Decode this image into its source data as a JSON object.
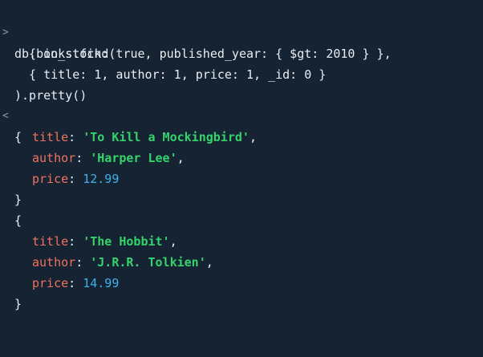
{
  "colors": {
    "background": "#152333",
    "key": "#f0715f",
    "string": "#34d36b",
    "number": "#3fb1ea",
    "text": "#e8edf2",
    "prompt": "#8a97a6"
  },
  "input": {
    "prompt_glyph": ">",
    "lines": [
      "db.books.find(",
      "  { in_stock: true, published_year: { $gt: 2010 } },",
      "  { title: 1, author: 1, price: 1, _id: 0 }",
      ").pretty()"
    ]
  },
  "output": {
    "result_glyph": "<",
    "open_brace": "{",
    "close_brace": "}",
    "comma": ",",
    "separator": ": ",
    "documents": [
      {
        "fields": [
          {
            "key": "title",
            "value": "'To Kill a Mockingbird'"
          },
          {
            "key": "author",
            "value": "'Harper Lee'"
          },
          {
            "key": "price",
            "value": "12.99"
          }
        ]
      },
      {
        "fields": [
          {
            "key": "title",
            "value": "'The Hobbit'"
          },
          {
            "key": "author",
            "value": "'J.R.R. Tolkien'"
          },
          {
            "key": "price",
            "value": "14.99"
          }
        ]
      }
    ]
  }
}
